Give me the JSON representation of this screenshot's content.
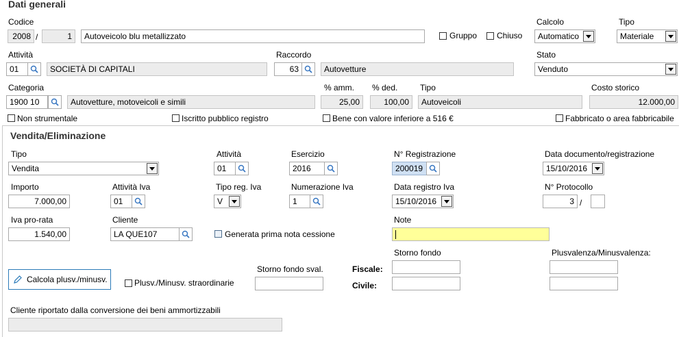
{
  "dati_generali": {
    "title": "Dati generali",
    "codice": {
      "label": "Codice",
      "anno": "2008",
      "separator": "/",
      "numero": "1",
      "descrizione": "Autoveicolo blu metallizzato"
    },
    "gruppo_label": "Gruppo",
    "chiuso_label": "Chiuso",
    "calcolo": {
      "label": "Calcolo",
      "value": "Automatico"
    },
    "tipo": {
      "label": "Tipo",
      "value": "Materiale"
    },
    "attivita": {
      "label": "Attività",
      "code": "01",
      "description": "SOCIETÀ DI CAPITALI"
    },
    "raccordo": {
      "label": "Raccordo",
      "code": "63",
      "description": "Autovetture"
    },
    "stato": {
      "label": "Stato",
      "value": "Venduto"
    },
    "categoria": {
      "label": "Categoria",
      "code": "1900 10",
      "description": "Autovetture, motoveicoli e simili"
    },
    "perc_amm": {
      "label": "% amm.",
      "value": "25,00"
    },
    "perc_ded": {
      "label": "% ded.",
      "value": "100,00"
    },
    "tipo_cat": {
      "label": "Tipo",
      "value": "Autoveicoli"
    },
    "costo_storico": {
      "label": "Costo storico",
      "value": "12.000,00"
    },
    "checks": {
      "non_strumentale": "Non strumentale",
      "iscritto": "Iscritto pubblico registro",
      "bene": "Bene con valore inferiore a 516 €",
      "fabbricato": "Fabbricato o area fabbricabile"
    }
  },
  "vendita": {
    "title": "Vendita/Eliminazione",
    "tipo": {
      "label": "Tipo",
      "value": "Vendita"
    },
    "attivita": {
      "label": "Attività",
      "value": "01"
    },
    "esercizio": {
      "label": "Esercizio",
      "value": "2016"
    },
    "n_registrazione": {
      "label": "N° Registrazione",
      "value": "200019"
    },
    "data_documento": {
      "label": "Data documento/registrazione",
      "value": "15/10/2016"
    },
    "importo": {
      "label": "Importo",
      "value": "7.000,00"
    },
    "attivita_iva": {
      "label": "Attività Iva",
      "value": "01"
    },
    "tipo_reg_iva": {
      "label": "Tipo reg. Iva",
      "value": "V"
    },
    "numerazione_iva": {
      "label": "Numerazione Iva",
      "value": "1"
    },
    "data_registro_iva": {
      "label": "Data registro Iva",
      "value": "15/10/2016"
    },
    "n_protocollo": {
      "label": "N° Protocollo",
      "value": "3",
      "separator": "/",
      "suffix": ""
    },
    "iva_pro_rata": {
      "label": "Iva pro-rata",
      "value": "1.540,00"
    },
    "cliente": {
      "label": "Cliente",
      "value": "LA QUE107"
    },
    "generata_label": "Generata prima nota cessione",
    "note": {
      "label": "Note",
      "value": ""
    },
    "calcola_button": "Calcola plusv./minusv.",
    "plusv_straord_label": "Plusv./Minusv. straordinarie",
    "storno_fondo_sval_label": "Storno fondo sval.",
    "storno_fondo_label": "Storno fondo",
    "plus_minus_label": "Plusvalenza/Minusvalenza:",
    "fiscale_label": "Fiscale:",
    "civile_label": "Civile:",
    "cliente_riportato_label": "Cliente riportato dalla conversione dei beni ammortizzabili"
  }
}
